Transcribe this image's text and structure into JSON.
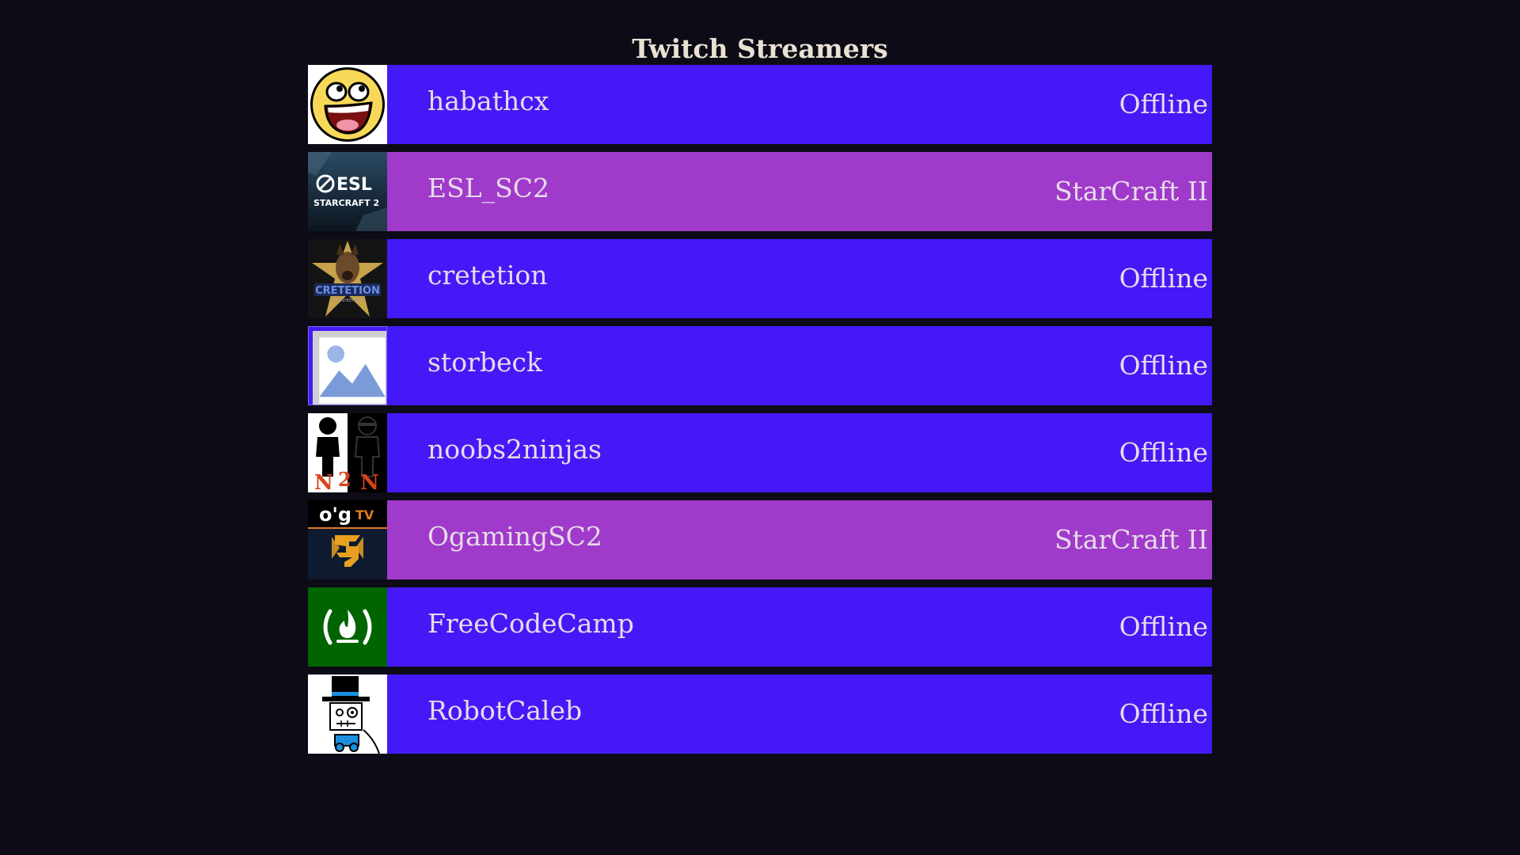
{
  "page": {
    "title": "Twitch Streamers"
  },
  "colors": {
    "background": "#0d0b16",
    "offline_bar": "#4519f7",
    "online_bar": "#a03acb",
    "text": "#e6dbe8"
  },
  "streamers": [
    {
      "name": "habathcx",
      "status": "Offline",
      "online": false,
      "logo_icon": "awesome-face-logo-icon"
    },
    {
      "name": "ESL_SC2",
      "status": "StarCraft II",
      "online": true,
      "logo_icon": "esl-starcraft2-logo-icon"
    },
    {
      "name": "cretetion",
      "status": "Offline",
      "online": false,
      "logo_icon": "cretetion-sheepdog-logo-icon"
    },
    {
      "name": "storbeck",
      "status": "Offline",
      "online": false,
      "logo_icon": "broken-image-icon"
    },
    {
      "name": "noobs2ninjas",
      "status": "Offline",
      "online": false,
      "logo_icon": "noobs2ninjas-logo-icon"
    },
    {
      "name": "OgamingSC2",
      "status": "StarCraft II",
      "online": true,
      "logo_icon": "ogtv-starcraft-logo-icon"
    },
    {
      "name": "FreeCodeCamp",
      "status": "Offline",
      "online": false,
      "logo_icon": "freecodecamp-logo-icon"
    },
    {
      "name": "RobotCaleb",
      "status": "Offline",
      "online": false,
      "logo_icon": "robot-top-hat-logo-icon"
    }
  ]
}
